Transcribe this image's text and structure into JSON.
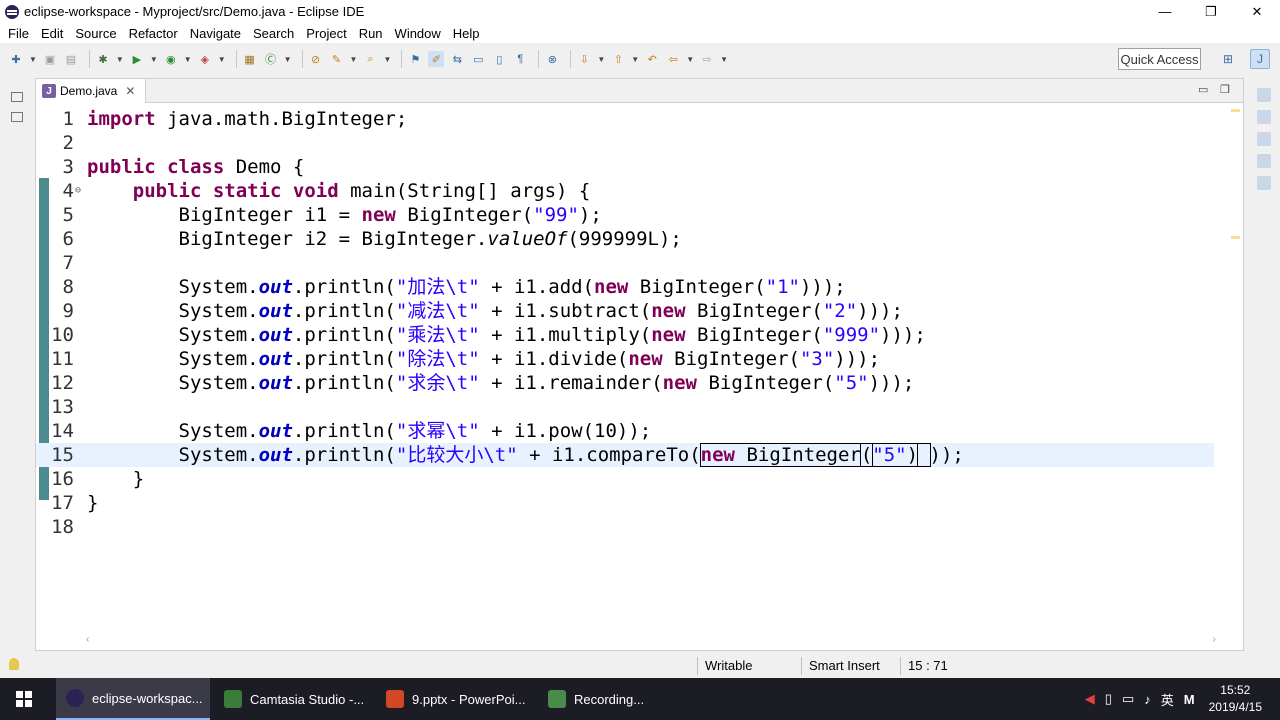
{
  "window": {
    "title": "eclipse-workspace - Myproject/src/Demo.java - Eclipse IDE",
    "controls": [
      "—",
      "❐",
      "✕"
    ]
  },
  "menu": [
    "File",
    "Edit",
    "Source",
    "Refactor",
    "Navigate",
    "Search",
    "Project",
    "Run",
    "Window",
    "Help"
  ],
  "toolbar": {
    "quick_access": "Quick Access"
  },
  "editor": {
    "tab_label": "Demo.java",
    "tab_close": "✕",
    "lines": [
      {
        "n": "1",
        "html": "<span class=\"kw\">import</span> java.math.BigInteger;"
      },
      {
        "n": "2",
        "html": ""
      },
      {
        "n": "3",
        "html": "<span class=\"kw\">public class</span> Demo {"
      },
      {
        "n": "4",
        "html": "    <span class=\"kw\">public static void</span> main(String[] args) {"
      },
      {
        "n": "5",
        "html": "        BigInteger i1 = <span class=\"kw\">new</span> BigInteger(<span class=\"str\">\"99\"</span>);"
      },
      {
        "n": "6",
        "html": "        BigInteger i2 = BigInteger.<span class=\"ital\">valueOf</span>(999999L);"
      },
      {
        "n": "7",
        "html": ""
      },
      {
        "n": "8",
        "html": "        System.<span class=\"fld\">out</span>.println(<span class=\"str\">\"加法\\t\"</span> + i1.add(<span class=\"kw\">new</span> BigInteger(<span class=\"str\">\"1\"</span>)));"
      },
      {
        "n": "9",
        "html": "        System.<span class=\"fld\">out</span>.println(<span class=\"str\">\"减法\\t\"</span> + i1.subtract(<span class=\"kw\">new</span> BigInteger(<span class=\"str\">\"2\"</span>)));"
      },
      {
        "n": "10",
        "html": "        System.<span class=\"fld\">out</span>.println(<span class=\"str\">\"乘法\\t\"</span> + i1.multiply(<span class=\"kw\">new</span> BigInteger(<span class=\"str\">\"999\"</span>)));"
      },
      {
        "n": "11",
        "html": "        System.<span class=\"fld\">out</span>.println(<span class=\"str\">\"除法\\t\"</span> + i1.divide(<span class=\"kw\">new</span> BigInteger(<span class=\"str\">\"3\"</span>)));"
      },
      {
        "n": "12",
        "html": "        System.<span class=\"fld\">out</span>.println(<span class=\"str\">\"求余\\t\"</span> + i1.remainder(<span class=\"kw\">new</span> BigInteger(<span class=\"str\">\"5\"</span>)));"
      },
      {
        "n": "13",
        "html": ""
      },
      {
        "n": "14",
        "html": "        System.<span class=\"fld\">out</span>.println(<span class=\"str\">\"求幂\\t\"</span> + i1.pow(10));"
      },
      {
        "n": "15",
        "html": "        System.<span class=\"fld\">out</span>.println(<span class=\"str\">\"比较大小\\t\"</span> + i1.compareTo(<span class=\"box\"><span class=\"kw\">new</span> BigInteger<span class=\"box\">(</span><span class=\"str\">\"5\"</span>)<span class=\"box\"> </span></span>));"
      },
      {
        "n": "16",
        "html": "    }"
      },
      {
        "n": "17",
        "html": "}"
      },
      {
        "n": "18",
        "html": ""
      }
    ]
  },
  "status": {
    "writable": "Writable",
    "insert_mode": "Smart Insert",
    "position": "15 : 71"
  },
  "taskbar": {
    "items": [
      "eclipse-workspac...",
      "Camtasia Studio -...",
      "9.pptx - PowerPoi...",
      "Recording..."
    ],
    "ime": "英",
    "ime2": "M",
    "time": "15:52",
    "date": "2019/4/15"
  },
  "colors": {
    "keyword": "#7f0055",
    "string": "#2a00ff",
    "field": "#0000c0",
    "current_line": "#e8f2fe",
    "taskbar": "#1c1c24"
  }
}
